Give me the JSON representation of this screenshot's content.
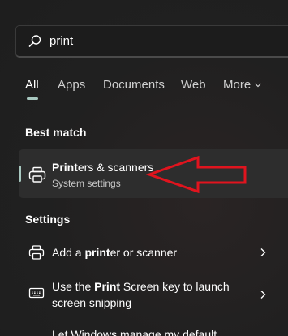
{
  "search": {
    "query": "print"
  },
  "tabs": [
    {
      "label": "All",
      "active": true
    },
    {
      "label": "Apps",
      "active": false
    },
    {
      "label": "Documents",
      "active": false
    },
    {
      "label": "Web",
      "active": false
    },
    {
      "label": "More",
      "active": false
    }
  ],
  "best_match": {
    "header": "Best match",
    "title_bold": "Print",
    "title_rest": "ers & scanners",
    "subtitle": "System settings",
    "icon": "printer-icon"
  },
  "settings": {
    "header": "Settings",
    "items": [
      {
        "icon": "printer-icon",
        "prefix": "Add a ",
        "bold": "print",
        "suffix": "er or scanner"
      },
      {
        "icon": "keyboard-icon",
        "prefix": "Use the ",
        "bold": "Print",
        "suffix": " Screen key to launch screen snipping"
      },
      {
        "icon": "",
        "prefix": "Let Windows manage my default",
        "bold": "",
        "suffix": ""
      }
    ]
  },
  "colors": {
    "accent": "#a8c8c0",
    "annotation_arrow": "#e0141e",
    "background": "#202020",
    "selected_background": "#2d2d2d"
  }
}
